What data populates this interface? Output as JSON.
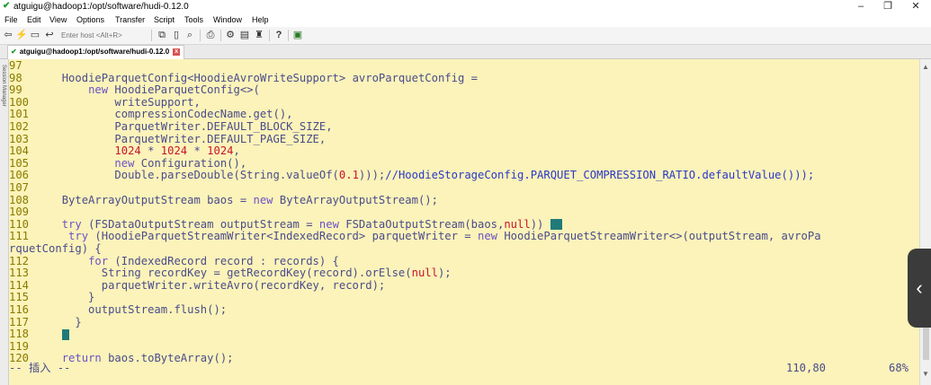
{
  "window": {
    "title": "atguigu@hadoop1:/opt/software/hudi-0.12.0",
    "controls": {
      "minimize": "–",
      "maximize": "❐",
      "close": "✕"
    }
  },
  "menu": [
    "File",
    "Edit",
    "View",
    "Options",
    "Transfer",
    "Script",
    "Tools",
    "Window",
    "Help"
  ],
  "toolbar": {
    "host_placeholder": "Enter host <Alt+R>",
    "icons": [
      "connect-icon",
      "lightning-icon",
      "reconnect-icon",
      "disconnect-icon",
      "copy-icon",
      "paste-icon",
      "find-icon",
      "print-icon",
      "settings-icon",
      "keymap-icon",
      "sftp-icon",
      "help-icon",
      "session-icon"
    ]
  },
  "tab": {
    "label": "atguigu@hadoop1:/opt/software/hudi-0.12.0",
    "close": "x"
  },
  "sidestrip": {
    "label": "Session Manager"
  },
  "terminal": {
    "lines": [
      {
        "num": "97",
        "segs": [
          {
            "t": "",
            "c": "tx"
          }
        ]
      },
      {
        "num": "98",
        "segs": [
          {
            "t": "    HoodieParquetConfig<HoodieAvroWriteSupport> avroParquetConfig =",
            "c": "tx"
          }
        ]
      },
      {
        "num": "99",
        "segs": [
          {
            "t": "        ",
            "c": "tx"
          },
          {
            "t": "new",
            "c": "kw"
          },
          {
            "t": " HoodieParquetConfig<>(",
            "c": "tx"
          }
        ]
      },
      {
        "num": "100",
        "segs": [
          {
            "t": "            writeSupport,",
            "c": "tx"
          }
        ]
      },
      {
        "num": "101",
        "segs": [
          {
            "t": "            compressionCodecName.get(),",
            "c": "tx"
          }
        ]
      },
      {
        "num": "102",
        "segs": [
          {
            "t": "            ParquetWriter.DEFAULT_BLOCK_SIZE,",
            "c": "tx"
          }
        ]
      },
      {
        "num": "103",
        "segs": [
          {
            "t": "            ParquetWriter.DEFAULT_PAGE_SIZE,",
            "c": "tx"
          }
        ]
      },
      {
        "num": "104",
        "segs": [
          {
            "t": "            ",
            "c": "tx"
          },
          {
            "t": "1024",
            "c": "nm"
          },
          {
            "t": " * ",
            "c": "tx"
          },
          {
            "t": "1024",
            "c": "nm"
          },
          {
            "t": " * ",
            "c": "tx"
          },
          {
            "t": "1024",
            "c": "nm"
          },
          {
            "t": ",",
            "c": "tx"
          }
        ]
      },
      {
        "num": "105",
        "segs": [
          {
            "t": "            ",
            "c": "tx"
          },
          {
            "t": "new",
            "c": "kw"
          },
          {
            "t": " Configuration(),",
            "c": "tx"
          }
        ]
      },
      {
        "num": "106",
        "segs": [
          {
            "t": "            Double.parseDouble(String.valueOf(",
            "c": "tx"
          },
          {
            "t": "0.1",
            "c": "nm"
          },
          {
            "t": ")));",
            "c": "tx"
          },
          {
            "t": "//HoodieStorageConfig.PARQUET_COMPRESSION_RATIO.defaultValue()));",
            "c": "cm"
          }
        ]
      },
      {
        "num": "107",
        "segs": [
          {
            "t": "",
            "c": "tx"
          }
        ]
      },
      {
        "num": "108",
        "segs": [
          {
            "t": "    ByteArrayOutputStream baos = ",
            "c": "tx"
          },
          {
            "t": "new",
            "c": "kw"
          },
          {
            "t": " ByteArrayOutputStream();",
            "c": "tx"
          }
        ]
      },
      {
        "num": "109",
        "segs": [
          {
            "t": "",
            "c": "tx"
          }
        ]
      },
      {
        "num": "110",
        "segs": [
          {
            "t": "    ",
            "c": "tx"
          },
          {
            "t": "try",
            "c": "kw"
          },
          {
            "t": " (FSDataOutputStream outputStream = ",
            "c": "tx"
          },
          {
            "t": "new",
            "c": "kw"
          },
          {
            "t": " FSDataOutputStream(baos,",
            "c": "tx"
          },
          {
            "t": "null",
            "c": "nm"
          },
          {
            "t": ")) ",
            "c": "tx"
          }
        ],
        "cursor": "big"
      },
      {
        "num": "111",
        "segs": [
          {
            "t": "     ",
            "c": "tx"
          },
          {
            "t": "try",
            "c": "kw"
          },
          {
            "t": " (HoodieParquetStreamWriter<IndexedRecord> parquetWriter = ",
            "c": "tx"
          },
          {
            "t": "new",
            "c": "kw"
          },
          {
            "t": " HoodieParquetStreamWriter<>(outputStream, avroPa",
            "c": "tx"
          }
        ]
      },
      {
        "num": "",
        "segs": [
          {
            "t": "rquetConfig) {",
            "c": "tx"
          }
        ]
      },
      {
        "num": "112",
        "segs": [
          {
            "t": "        ",
            "c": "tx"
          },
          {
            "t": "for",
            "c": "kw"
          },
          {
            "t": " (IndexedRecord record : records) {",
            "c": "tx"
          }
        ]
      },
      {
        "num": "113",
        "segs": [
          {
            "t": "          String recordKey = getRecordKey(record).orElse(",
            "c": "tx"
          },
          {
            "t": "null",
            "c": "nm"
          },
          {
            "t": ");",
            "c": "tx"
          }
        ]
      },
      {
        "num": "114",
        "segs": [
          {
            "t": "          parquetWriter.writeAvro(recordKey, record);",
            "c": "tx"
          }
        ]
      },
      {
        "num": "115",
        "segs": [
          {
            "t": "        }",
            "c": "tx"
          }
        ]
      },
      {
        "num": "116",
        "segs": [
          {
            "t": "        outputStream.flush();",
            "c": "tx"
          }
        ]
      },
      {
        "num": "117",
        "segs": [
          {
            "t": "      }",
            "c": "tx"
          }
        ]
      },
      {
        "num": "118",
        "segs": [
          {
            "t": "    ",
            "c": "tx"
          }
        ],
        "cursor": "small"
      },
      {
        "num": "119",
        "segs": [
          {
            "t": "",
            "c": "tx"
          }
        ]
      },
      {
        "num": "120",
        "segs": [
          {
            "t": "    ",
            "c": "tx"
          },
          {
            "t": "return",
            "c": "kw"
          },
          {
            "t": " baos.toByteArray();",
            "c": "tx"
          }
        ]
      }
    ],
    "status": {
      "mode": "-- 插入 --",
      "position": "110,80",
      "percent": "68%"
    }
  },
  "colors": {
    "background": "#fbf3b9",
    "text": "#4b4b8c",
    "line_number": "#8a7a00",
    "keyword": "#6b52c7",
    "number": "#c8142b",
    "comment": "#2a38c8",
    "cursor": "#1f7a78"
  }
}
